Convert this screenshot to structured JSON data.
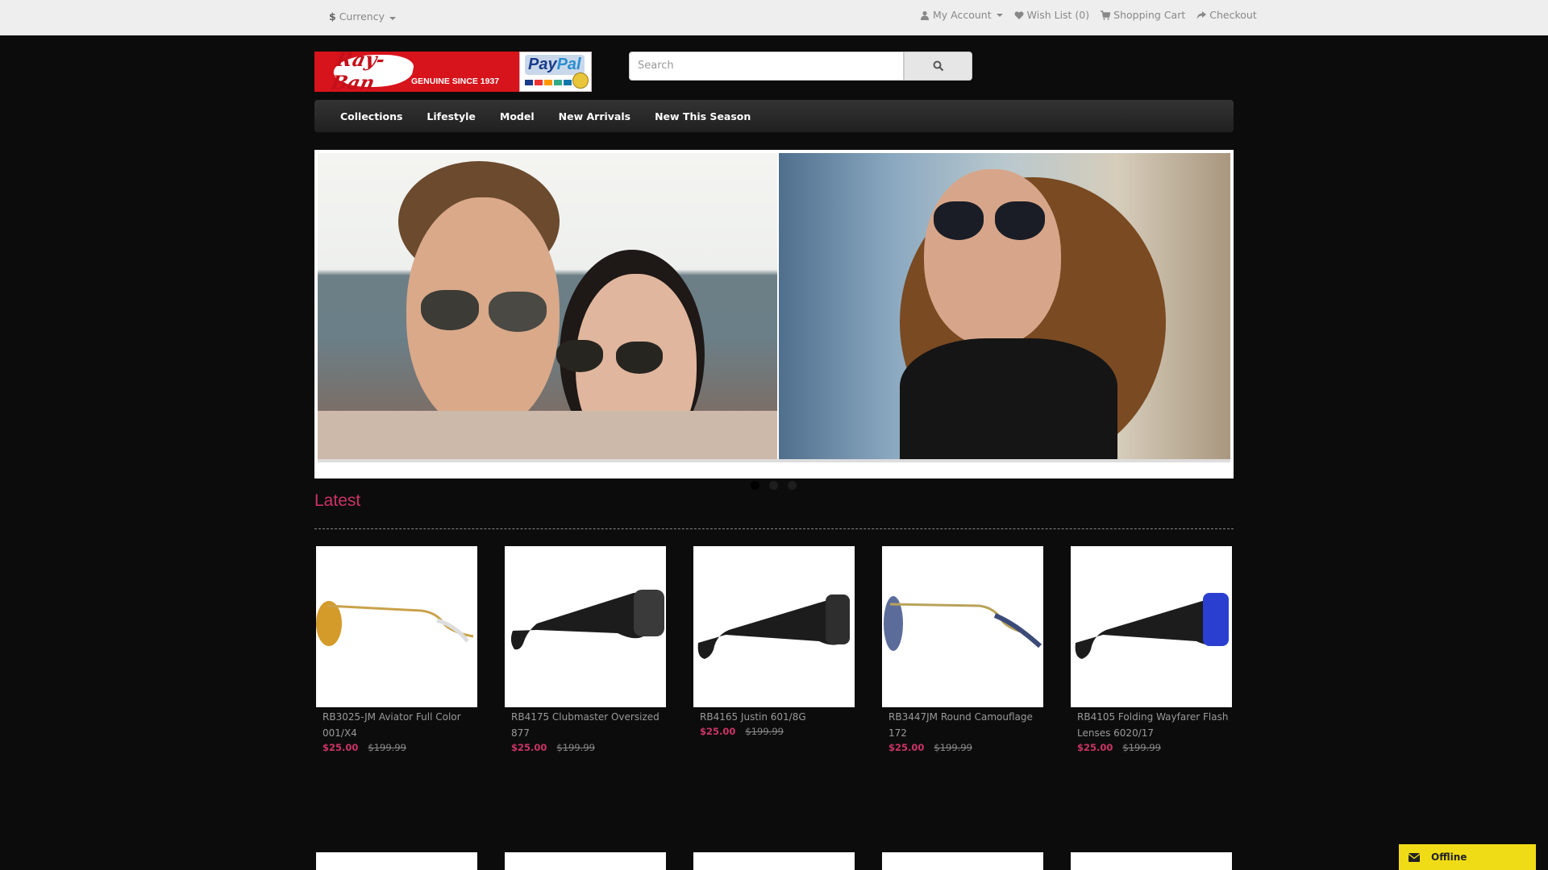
{
  "topbar": {
    "currency_symbol": "$",
    "currency_label": "Currency",
    "my_account": "My Account",
    "wish_list": "Wish List (0)",
    "shopping_cart": "Shopping Cart",
    "checkout": "Checkout"
  },
  "logo": {
    "script": "Ray-Ban",
    "tagline": "GENUINE SINCE 1937",
    "paypal_word_1": "Pay",
    "paypal_word_2": "Pal"
  },
  "search": {
    "placeholder": "Search",
    "icon": "search-icon"
  },
  "menu": {
    "items": [
      "Collections",
      "Lifestyle",
      "Model",
      "New Arrivals",
      "New This Season"
    ]
  },
  "slideshow": {
    "slide_count": 3,
    "active_index": 0
  },
  "latest": {
    "title": "Latest",
    "products": [
      {
        "name": "RB3025-JM Aviator Full Color 001/X4",
        "price": "$25.00",
        "old_price": "$199.99",
        "frame_color": "#c9a24a",
        "lens_color": "#d49a2a"
      },
      {
        "name": "RB4175 Clubmaster Oversized 877",
        "price": "$25.00",
        "old_price": "$199.99",
        "frame_color": "#1c1c1c",
        "lens_color": "#3a3a3a"
      },
      {
        "name": "RB4165 Justin 601/8G",
        "price": "$25.00",
        "old_price": "$199.99",
        "frame_color": "#1c1c1c",
        "lens_color": "#3a3a3a"
      },
      {
        "name": "RB3447JM Round Camouflage 172",
        "price": "$25.00",
        "old_price": "$199.99",
        "frame_color": "#b9a35a",
        "lens_color": "#5c6c9a"
      },
      {
        "name": "RB4105 Folding Wayfarer Flash Lenses 6020/17",
        "price": "$25.00",
        "old_price": "$199.99",
        "frame_color": "#1c1c1c",
        "lens_color": "#2a3fd0"
      }
    ]
  },
  "chat": {
    "label": "Offline",
    "icon": "envelope-icon"
  }
}
